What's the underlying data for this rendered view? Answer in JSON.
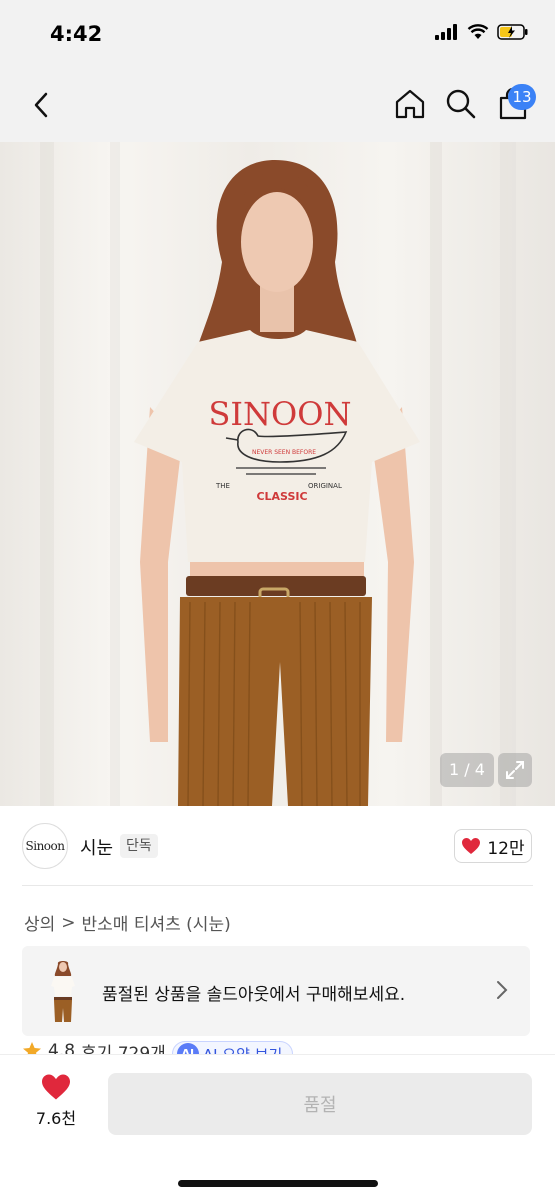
{
  "status_bar": {
    "time": "4:42"
  },
  "header": {
    "cart_count": "13"
  },
  "image": {
    "counter": "1 / 4",
    "shirt_brand_text": "SINOON",
    "shirt_badge_text": "NEVER SEEN BEFORE",
    "shirt_left_text": "THE",
    "shirt_right_text": "ORIGINAL",
    "shirt_bottom_text": "CLASSIC"
  },
  "brand": {
    "logo_text": "Sinoon",
    "name": "시눈",
    "tag": "단독",
    "like_count": "12만"
  },
  "breadcrumb": {
    "category": "상의",
    "separator": ">",
    "subcategory": "반소매 티셔츠 (시눈)"
  },
  "banner": {
    "text": "품절된 상품을 솔드아웃에서 구매해보세요."
  },
  "review": {
    "rating": "4.8",
    "count": "후기 729개",
    "ai_label": "AI",
    "ai_text": "AI 요약 보기"
  },
  "bottom": {
    "wish_count": "7.6천",
    "cta": "품절"
  },
  "colors": {
    "accent": "#3b82f6",
    "heart": "#e0283c",
    "cta_bg": "#ebebeb"
  }
}
